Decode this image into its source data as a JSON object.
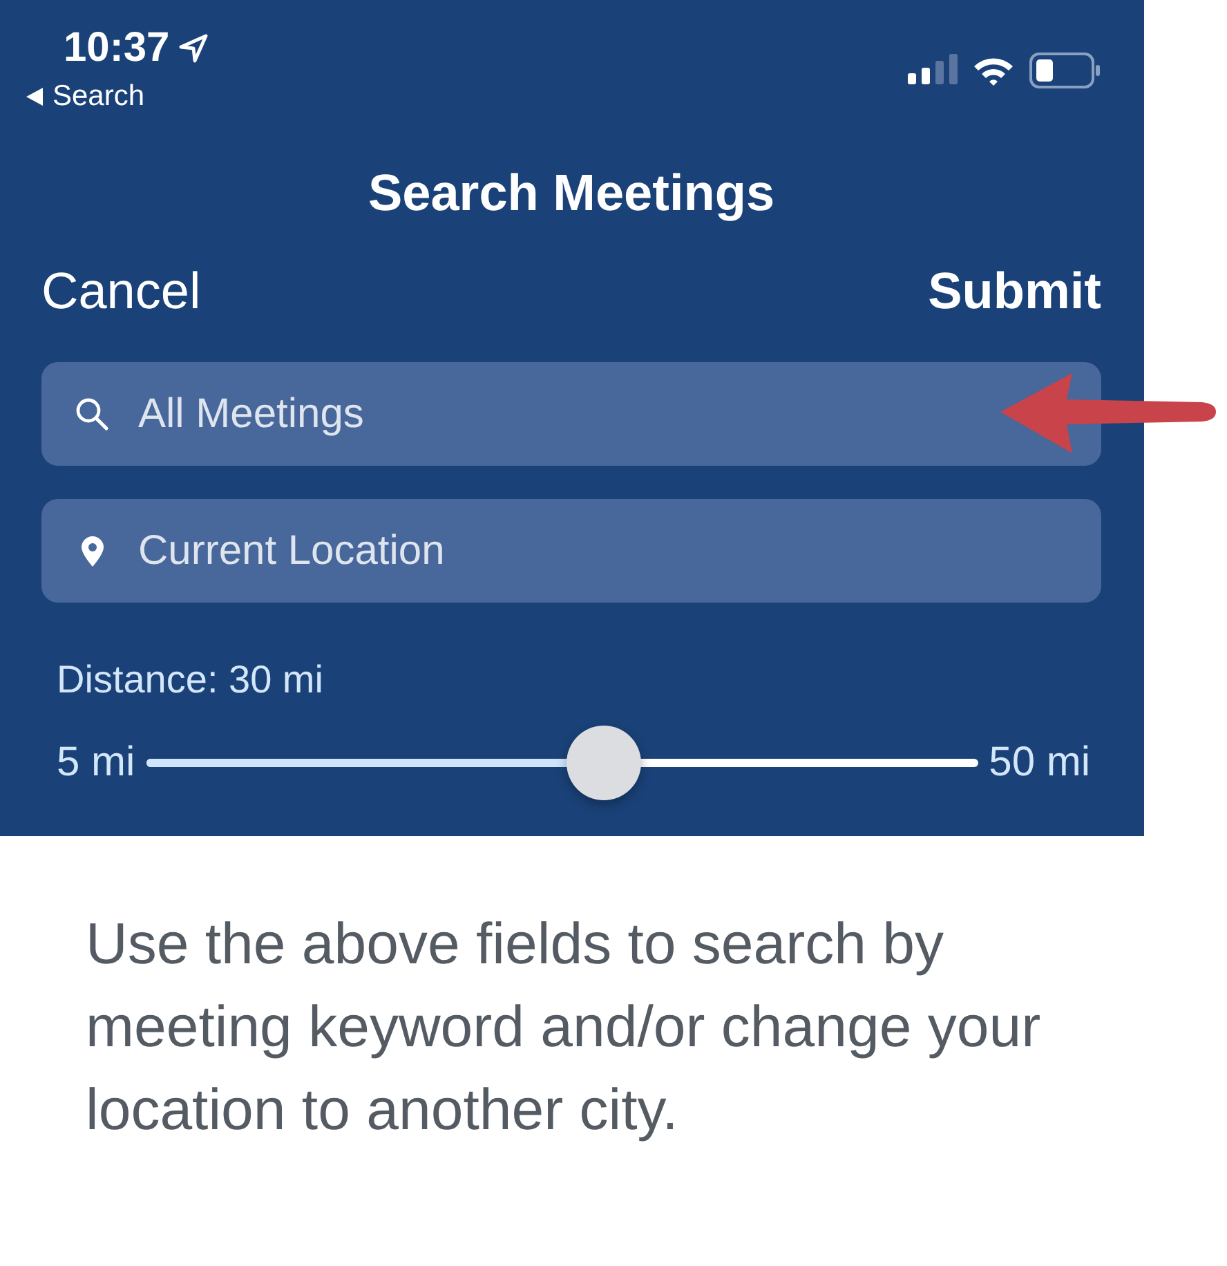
{
  "status_bar": {
    "time": "10:37",
    "back_label": "Search"
  },
  "nav": {
    "title": "Search Meetings",
    "left_button": "Cancel",
    "right_button": "Submit"
  },
  "fields": [
    {
      "kind": "search",
      "placeholder": "All Meetings"
    },
    {
      "kind": "location",
      "placeholder": "Current Location"
    }
  ],
  "distance": {
    "label": "Distance: 30 mi",
    "min_label": "5 mi",
    "max_label": "50 mi",
    "level": 0.55
  },
  "caption": "Use the above fields to search by meeting keyword and/or change your location to another city."
}
